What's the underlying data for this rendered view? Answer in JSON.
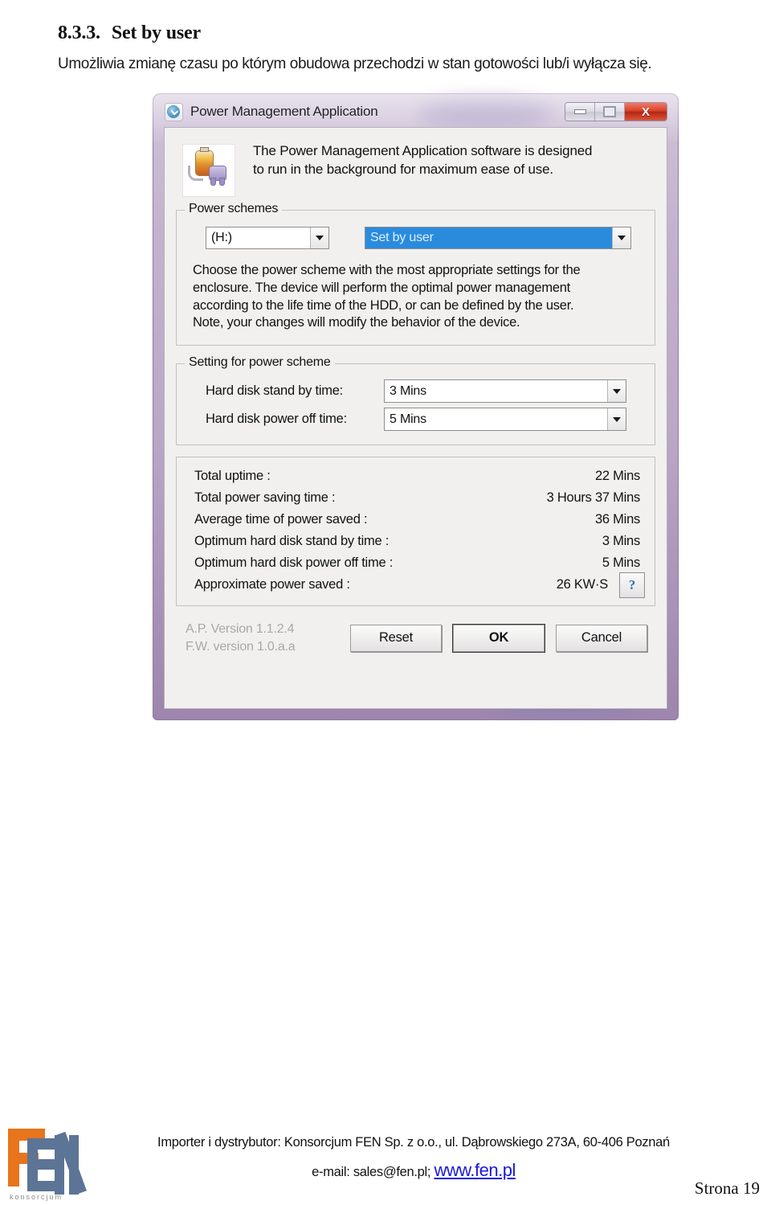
{
  "document": {
    "section_number": "8.3.3.",
    "section_title": "Set by user",
    "description": "Umożliwia zmianę czasu po którym obudowa przechodzi w stan gotowości lub/i wyłącza się."
  },
  "window": {
    "title": "Power Management Application",
    "icon": "app-circle-icon",
    "caption_buttons": {
      "minimize": "minimize-icon",
      "maximize": "maximize-icon",
      "close": "X"
    },
    "banner": {
      "icon": "battery-power-plug-icon",
      "line1": "The Power Management Application software is designed",
      "line2": "to run in the background for maximum ease of use."
    },
    "power_schemes": {
      "group_title": "Power schemes",
      "drive_combo": {
        "value": "(H:)",
        "arrow": "chevron-down-icon"
      },
      "scheme_combo": {
        "value": "Set by user",
        "arrow": "chevron-down-icon",
        "selected": true
      },
      "description_lines": [
        "Choose the power scheme with the most appropriate settings for the",
        "enclosure. The device will perform the optimal power management",
        "according to the life time of the HDD, or can be defined by the user.",
        "Note, your changes will modify the behavior of the device."
      ]
    },
    "setting_group": {
      "group_title": "Setting for power scheme",
      "rows": [
        {
          "label": "Hard disk stand by time:",
          "value": "3 Mins"
        },
        {
          "label": "Hard disk power off time:",
          "value": "5 Mins"
        }
      ]
    },
    "stats": [
      {
        "label": "Total uptime :",
        "value": "22 Mins"
      },
      {
        "label": "Total power saving time :",
        "value": "3 Hours 37 Mins"
      },
      {
        "label": "Average time of power saved :",
        "value": "36 Mins"
      },
      {
        "label": "Optimum hard disk stand by time :",
        "value": "3 Mins"
      },
      {
        "label": "Optimum hard disk power off time :",
        "value": "5 Mins"
      },
      {
        "label": "Approximate power saved :",
        "value": "26 KW·S"
      }
    ],
    "help_button": "?",
    "versions": {
      "app": "A.P. Version 1.1.2.4",
      "firmware": "F.W. version 1.0.a.a"
    },
    "buttons": {
      "reset": "Reset",
      "ok": "OK",
      "cancel": "Cancel"
    }
  },
  "footer": {
    "logo_caption": "konsorcjum",
    "line1": "Importer i dystrybutor: Konsorcjum FEN Sp. z o.o., ul. Dąbrowskiego 273A, 60-406 Poznań",
    "line2_prefix": "e-mail: sales@fen.pl; ",
    "link": "www.fen.pl",
    "page": "Strona 19"
  },
  "colors": {
    "accent_blue": "#2a8bdd",
    "close_red": "#c7341c",
    "glass_purple": "#b9a7c6",
    "logo_orange": "#e8741c",
    "logo_blue": "#5c7496",
    "link_blue": "#1a1ad6"
  }
}
